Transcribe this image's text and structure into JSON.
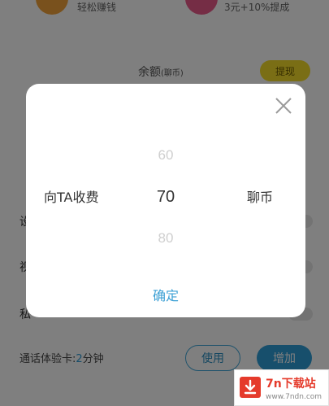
{
  "background": {
    "promo_left_text": "轻松赚钱",
    "promo_right_text": "3元+10%提成",
    "balance_label": "余额",
    "balance_unit": "(聊币)",
    "withdraw_label": "提现",
    "trial_label": "通话体验卡:",
    "trial_value": "2",
    "trial_unit": "分钟",
    "use_label": "使用",
    "add_label": "增加"
  },
  "dialog": {
    "charge_label": "向TA收费",
    "unit_label": "聊币",
    "picker": {
      "prev": "60",
      "selected": "70",
      "next": "80"
    },
    "confirm_label": "确定"
  },
  "watermark": {
    "title": "7n下载站",
    "url": "www.7ndn.com"
  },
  "colors": {
    "accent": "#3a9fd4",
    "overlay": "rgba(0,0,0,0.5)",
    "withdraw": "#f5dc2a",
    "watermark_red": "#e53a2b"
  }
}
